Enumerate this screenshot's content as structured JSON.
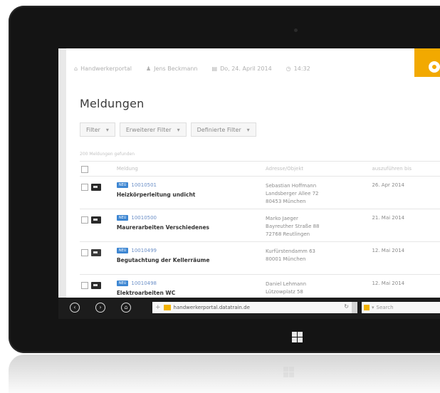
{
  "header": {
    "portal": "Handwerkerportal",
    "user": "Jens Beckmann",
    "date": "Do, 24. April 2014",
    "time": "14:32"
  },
  "page": {
    "title": "Meldungen",
    "results_info": "200 Meldungen gefunden"
  },
  "filters": [
    {
      "label": "Filter"
    },
    {
      "label": "Erweiterer Filter"
    },
    {
      "label": "Definierte Filter"
    }
  ],
  "table": {
    "columns": [
      "Meldung",
      "Adresse/Objekt",
      "auszuführen bis"
    ],
    "rows": [
      {
        "id": "10010501",
        "badge": "NEU",
        "title": "Heizkörperleitung undicht",
        "addr": [
          "Sebastian Hoffmann",
          "Landsberger Allee 72",
          "80453 München"
        ],
        "date": "26. Apr 2014"
      },
      {
        "id": "10010500",
        "badge": "NEU",
        "title": "Maurerarbeiten Verschiedenes",
        "addr": [
          "Marko Jaeger",
          "Bayreuther Straße 88",
          "72768 Reutlingen"
        ],
        "date": "21. Mai 2014"
      },
      {
        "id": "10010499",
        "badge": "NEU",
        "title": "Begutachtung der Kellerräume",
        "addr": [
          "Kurfürstendamm 63",
          "80001 München"
        ],
        "date": "12. Mai 2014"
      },
      {
        "id": "10010498",
        "badge": "NEU",
        "title": "Elektroarbeiten WC",
        "addr": [
          "Daniel Lehmann",
          "Lützowplatz 58"
        ],
        "date": "12. Mai 2014"
      }
    ]
  },
  "browser": {
    "url": "handwerkerportal.datatrain.de",
    "search_placeholder": "Search"
  },
  "colors": {
    "accent": "#f2a900",
    "badge": "#3d86d2",
    "frame": "#141414"
  }
}
